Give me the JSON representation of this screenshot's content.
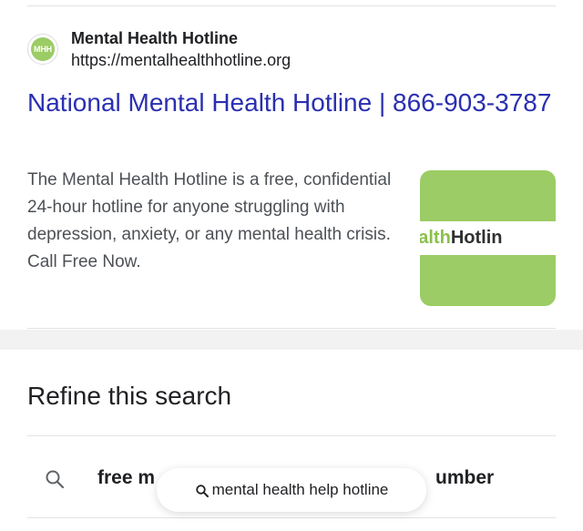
{
  "result": {
    "favicon_text": "MHH",
    "site_name": "Mental Health Hotline",
    "site_url": "https://mentalhealthhotline.org",
    "title": "National Mental Health Hotline | 866-903-3787",
    "snippet": "The Mental Health Hotline is a free, confidential 24-hour hotline for anyone struggling with depression, anxiety, or any mental health crisis. Call Free Now.",
    "thumbnail": {
      "text_green": "alHealth",
      "text_dark": "Hotlin",
      "bg_color": "#9ccc65"
    }
  },
  "refine": {
    "title": "Refine this search",
    "suggestion_visible": "free m",
    "suggestion_visible_end": "umber"
  },
  "floating_chip": {
    "icon": "search-icon",
    "label": "mental health help hotline"
  },
  "colors": {
    "link": "#2a2fb0",
    "snippet": "#4d5156",
    "brand_green": "#9ccc65"
  }
}
